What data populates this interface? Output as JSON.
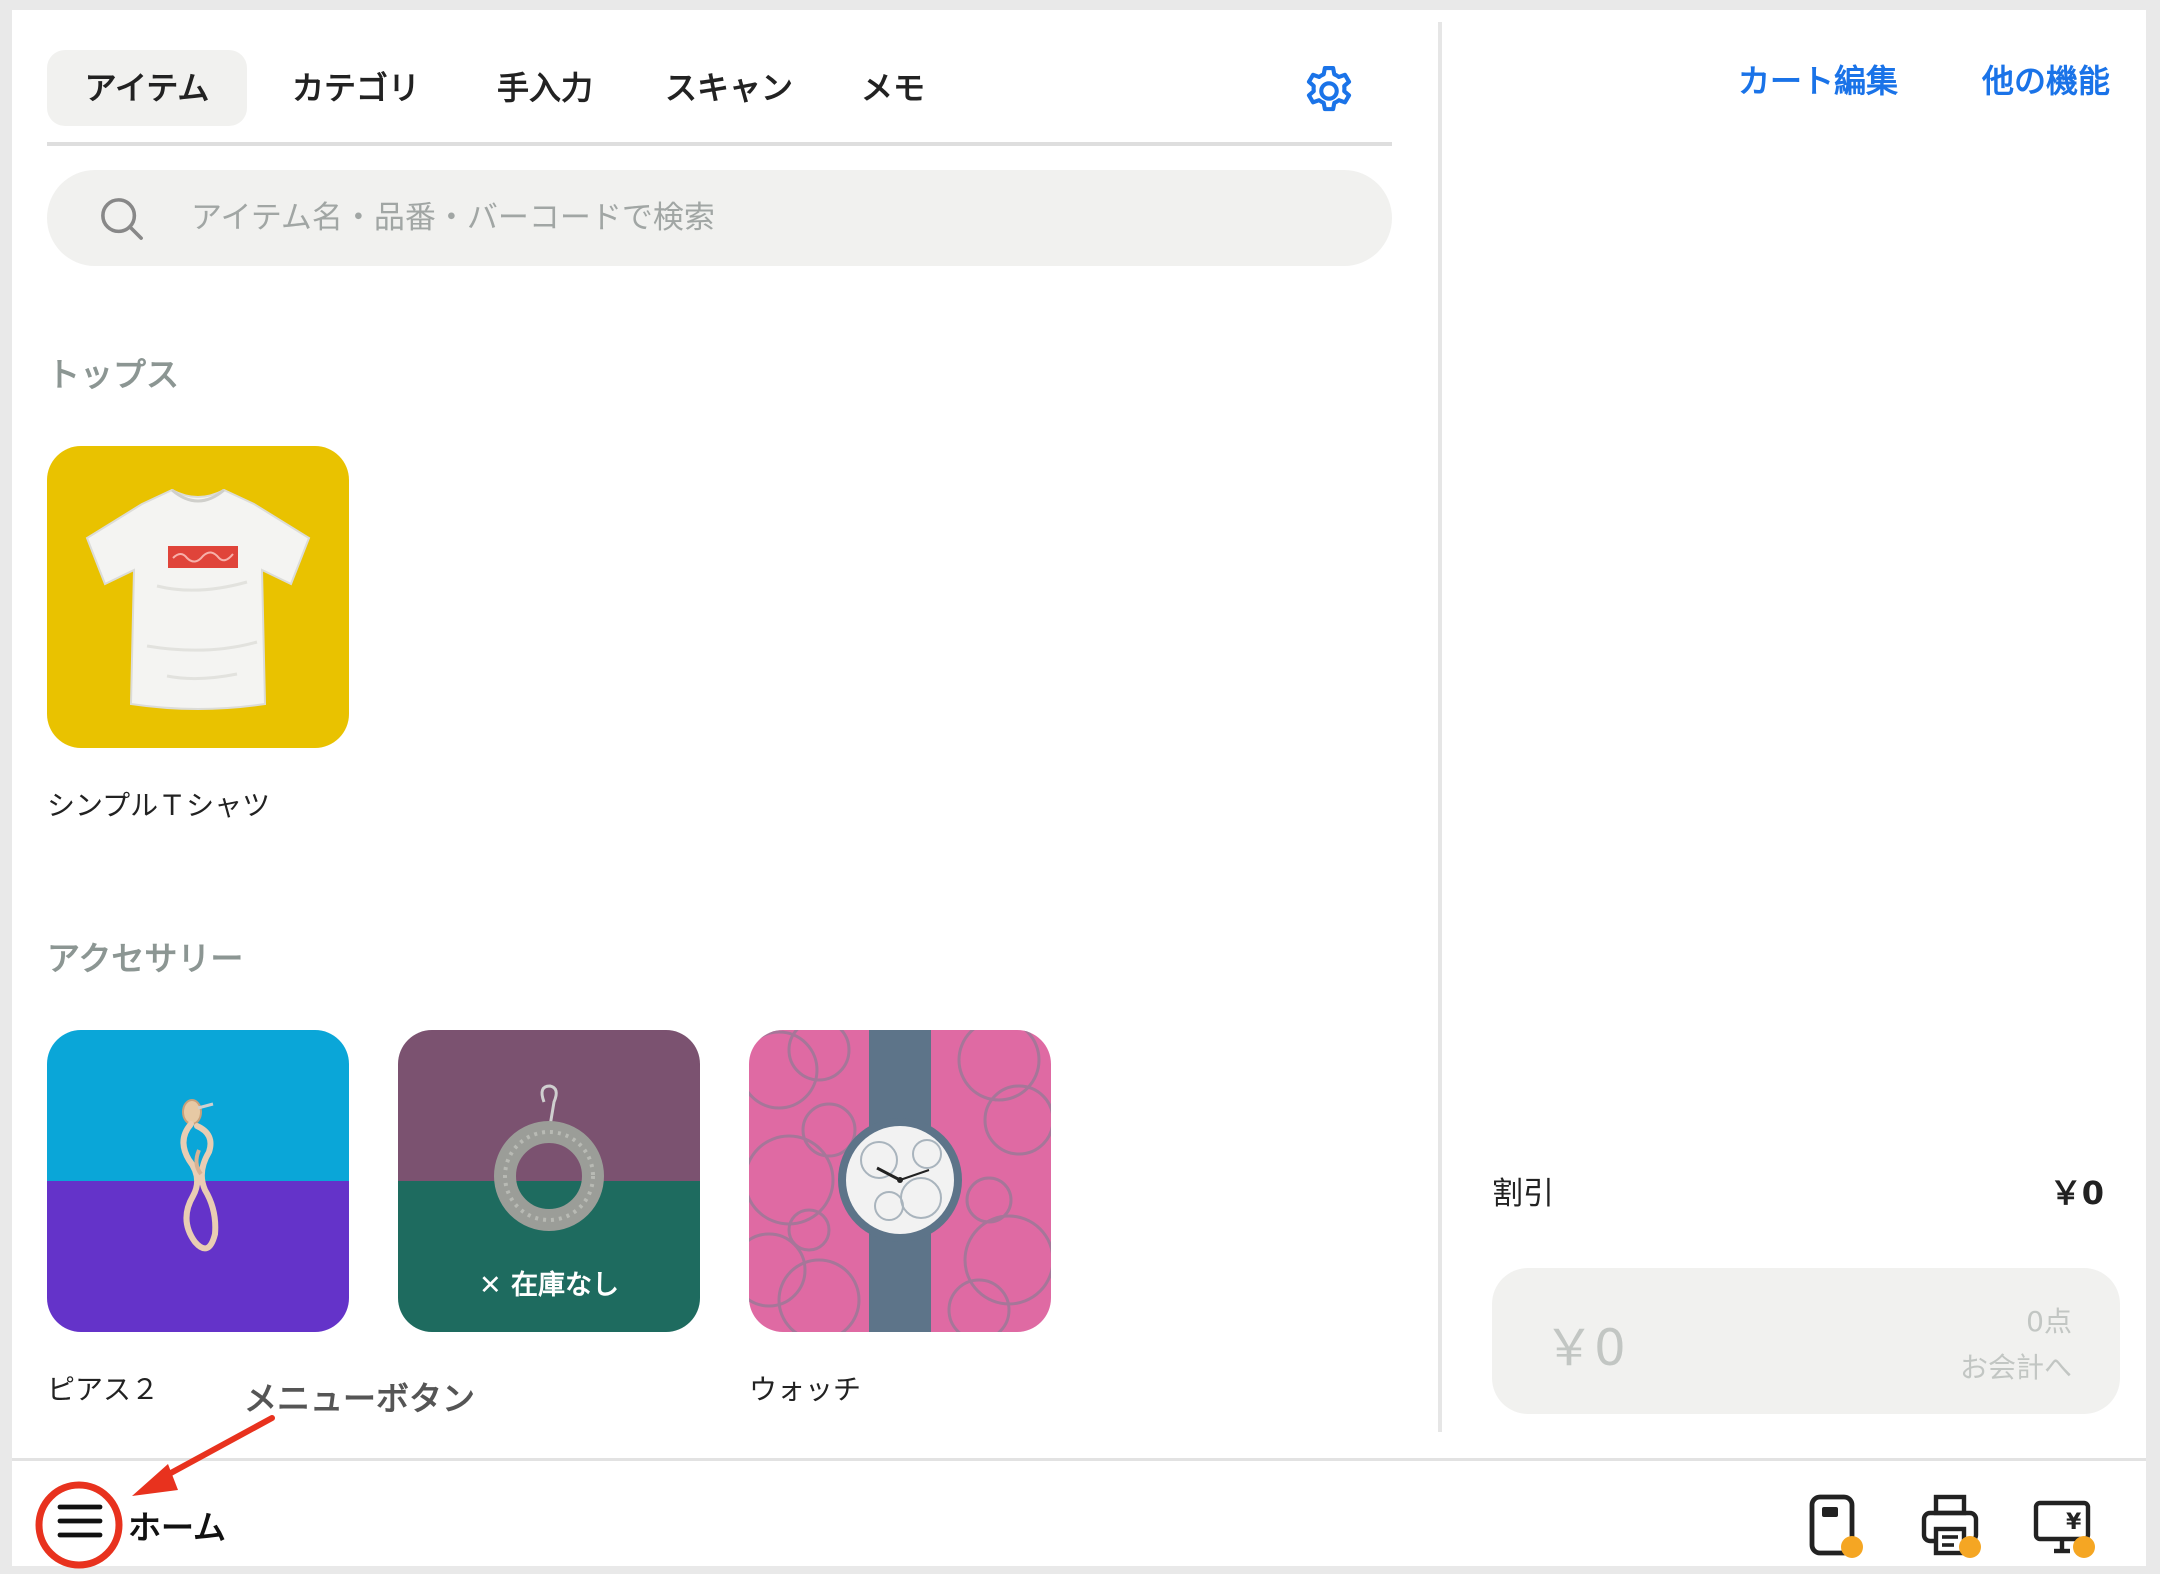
{
  "tabs": [
    {
      "label": "アイテム",
      "active": true
    },
    {
      "label": "カテゴリ",
      "active": false
    },
    {
      "label": "手入力",
      "active": false
    },
    {
      "label": "スキャン",
      "active": false
    },
    {
      "label": "メモ",
      "active": false
    }
  ],
  "search": {
    "placeholder": "アイテム名・品番・バーコードで検索"
  },
  "sections": [
    {
      "title": "トップス",
      "items": [
        {
          "name": "シンプルＴシャツ"
        }
      ]
    },
    {
      "title": "アクセサリー",
      "items": [
        {
          "name": "ピアス２"
        },
        {
          "name": "",
          "badge": "在庫なし"
        },
        {
          "name": "ウォッチ"
        }
      ]
    }
  ],
  "cart": {
    "edit_label": "カート編集",
    "more_label": "他の機能",
    "discount_label": "割引",
    "discount_value": "￥0",
    "total": "￥0",
    "count": "0点",
    "checkout_label": "お会計へ"
  },
  "bottom_bar": {
    "home_label": "ホーム"
  },
  "annotation": {
    "label": "メニューボタン",
    "color": "#e8321e"
  },
  "colors": {
    "accent": "#1a73e8",
    "badge_dot": "#f5a623"
  },
  "icons": [
    "gear-icon",
    "search-icon",
    "menu-icon",
    "card-reader-icon",
    "receipt-printer-icon",
    "customer-display-icon"
  ]
}
